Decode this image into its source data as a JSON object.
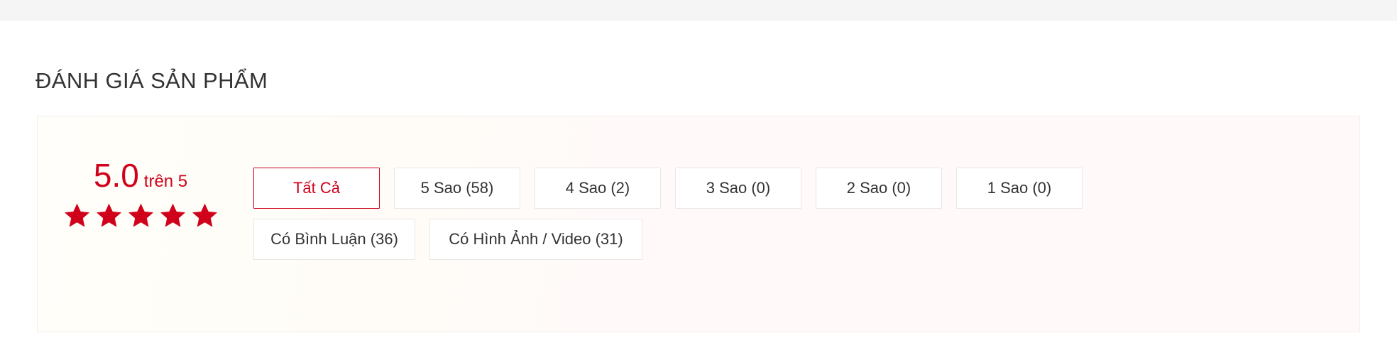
{
  "section": {
    "title": "ĐÁNH GIÁ SẢN PHẨM"
  },
  "rating_summary": {
    "score": "5.0",
    "out_of_label": "trên 5",
    "stars_filled": 5,
    "stars_total": 5,
    "accent_color": "#d0021b"
  },
  "filters": {
    "rows": [
      {
        "buttons": [
          {
            "label": "Tất Cả",
            "active": true,
            "size": "normal"
          },
          {
            "label": "5 Sao (58)",
            "active": false,
            "size": "normal"
          },
          {
            "label": "4 Sao (2)",
            "active": false,
            "size": "normal"
          },
          {
            "label": "3 Sao (0)",
            "active": false,
            "size": "normal"
          },
          {
            "label": "2 Sao (0)",
            "active": false,
            "size": "normal"
          },
          {
            "label": "1 Sao (0)",
            "active": false,
            "size": "normal"
          }
        ]
      },
      {
        "buttons": [
          {
            "label": "Có Bình Luận (36)",
            "active": false,
            "size": "wide"
          },
          {
            "label": "Có Hình Ảnh / Video (31)",
            "active": false,
            "size": "widest"
          }
        ]
      }
    ]
  },
  "colors": {
    "accent": "#d0021b",
    "panel_background": "#fffaf8",
    "text": "#333333",
    "border": "#e8e8e8"
  }
}
